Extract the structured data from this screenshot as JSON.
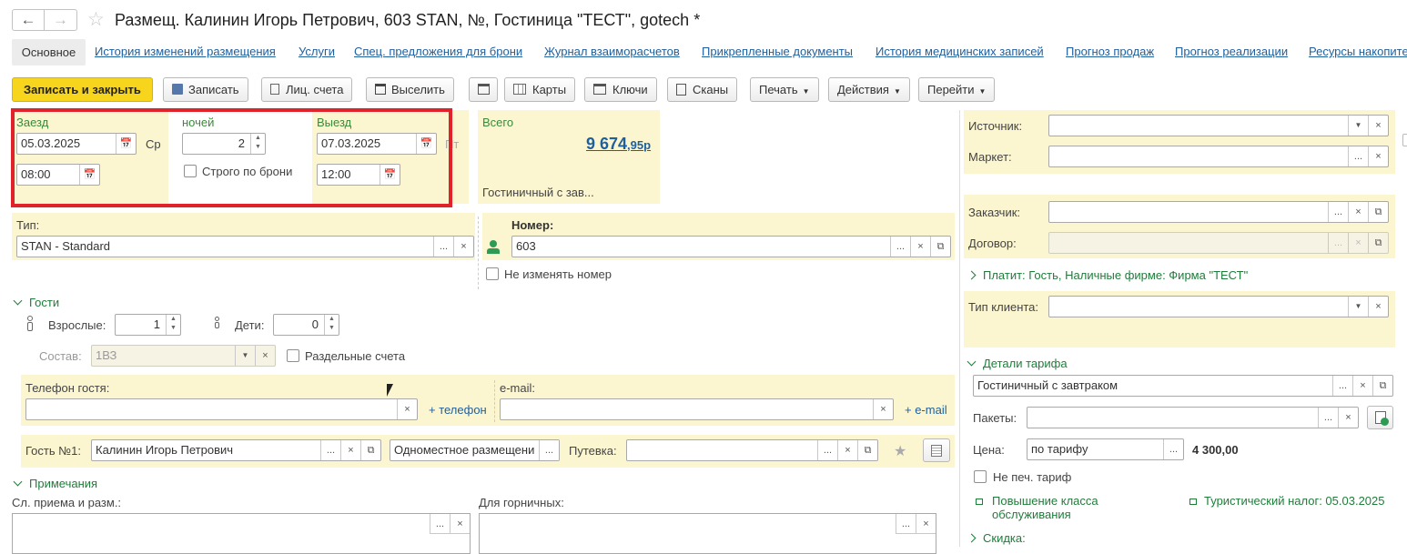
{
  "window": {
    "title": "Размещ. Калинин Игорь Петрович, 603 STAN, №, Гостиница \"ТЕСТ\", gotech *"
  },
  "tabs": [
    "Основное",
    "История изменений размещения",
    "Услуги",
    "Спец. предложения для брони",
    "Журнал взаиморасчетов",
    "Прикрепленные документы",
    "История медицинских записей",
    "Прогноз продаж",
    "Прогноз реализации",
    "Ресурсы накопите"
  ],
  "toolbar": {
    "save_close": "Записать и закрыть",
    "save": "Записать",
    "accounts": "Лиц. счета",
    "checkout": "Выселить",
    "cards": "Карты",
    "keys": "Ключи",
    "scans": "Сканы",
    "print": "Печать",
    "actions": "Действия",
    "goto": "Перейти"
  },
  "dates": {
    "checkin_label": "Заезд",
    "checkin_date": "05.03.2025",
    "checkin_dow": "Ср",
    "checkin_time": "08:00",
    "nights_label": "ночей",
    "nights": "2",
    "strict_label": "Строго по брони",
    "checkout_label": "Выезд",
    "checkout_date": "07.03.2025",
    "checkout_dow": "Пт",
    "checkout_time": "12:00"
  },
  "total": {
    "label": "Всего",
    "amount": "9 674",
    "cents": ",95",
    "currency": "р",
    "tariff": "Гостиничный с зав..."
  },
  "room": {
    "type_label": "Тип:",
    "type_value": "STAN - Standard",
    "number_label": "Номер:",
    "number_value": "603",
    "no_change_label": "Не изменять номер"
  },
  "guests": {
    "header": "Гости",
    "adults_label": "Взрослые:",
    "adults": "1",
    "children_label": "Дети:",
    "children": "0",
    "composition_label": "Состав:",
    "composition": "1ВЗ",
    "separate_label": "Раздельные счета",
    "phone_label": "Телефон гостя:",
    "add_phone": "+ телефон",
    "email_label": "e-mail:",
    "add_email": "+ e-mail",
    "guest1_label": "Гость №1:",
    "guest1_name": "Калинин Игорь Петрович",
    "accommodation": "Одноместное размещени",
    "voucher_label": "Путевка:"
  },
  "notes": {
    "header": "Примечания",
    "reception_label": "Сл. приема и разм.:",
    "maids_label": "Для горничных:"
  },
  "right": {
    "source_label": "Источник:",
    "market_label": "Маркет:",
    "customer_label": "Заказчик:",
    "contract_label": "Договор:",
    "payer": "Платит: Гость, Наличные фирме: Фирма \"ТЕСТ\"",
    "client_type_label": "Тип клиента:",
    "tariff_header": "Детали тарифа",
    "tariff_value": "Гостиничный с завтраком",
    "packages_label": "Пакеты:",
    "price_label": "Цена:",
    "price_mode": "по тарифу",
    "price_value": "4 300,00",
    "no_print_label": "Не печ. тариф",
    "upgrade": "Повышение класса обслуживания",
    "tax": "Туристический налог: 05.03.2025",
    "discount": "Скидка:"
  },
  "colors": {
    "accent_yellow": "#fbf5d0",
    "primary_button": "#f7d51d",
    "highlight_red": "#e0232b",
    "link": "#1f5f9d",
    "group_green": "#1f7d3a"
  }
}
